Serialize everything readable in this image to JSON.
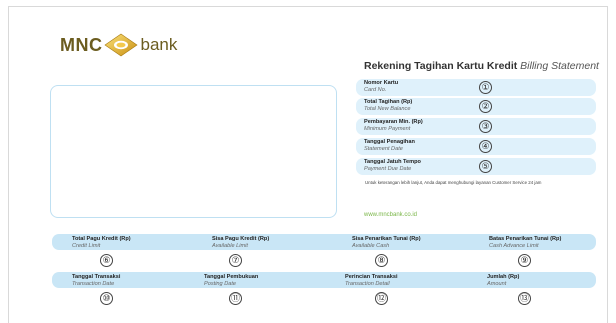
{
  "logo": {
    "left_text": "MNC",
    "right_text": "bank"
  },
  "header": {
    "title": "Rekening Tagihan Kartu Kredit",
    "title_en": "Billing Statement"
  },
  "info_rows": [
    {
      "label": "Nomor Kartu",
      "sub": "Card No.",
      "num": "①"
    },
    {
      "label": "Total Tagihan (Rp)",
      "sub": "Total New Balance",
      "num": "②"
    },
    {
      "label": "Pembayaran Min. (Rp)",
      "sub": "Minimum Payment",
      "num": "③"
    },
    {
      "label": "Tanggal Penagihan",
      "sub": "Statement Date",
      "num": "④"
    },
    {
      "label": "Tanggal Jatuh Tempo",
      "sub": "Payment Due Date",
      "num": "⑤"
    }
  ],
  "note": "Untuk keterangan lebih lanjut, Anda dapat menghubungi layanan Customer Service 24 jam",
  "website": "www.mncbank.co.id",
  "summary": [
    {
      "label": "Total Pagu Kredit (Rp)",
      "sub": "Credit Limit",
      "num": "⑥"
    },
    {
      "label": "Sisa Pagu Kredit (Rp)",
      "sub": "Available Limit",
      "num": "⑦"
    },
    {
      "label": "Sisa Penarikan Tunai (Rp)",
      "sub": "Available Cash",
      "num": "⑧"
    },
    {
      "label": "Batas Penarikan Tunai (Rp)",
      "sub": "Cash Advance Limit",
      "num": "⑨"
    }
  ],
  "transactions": [
    {
      "label": "Tanggal Transaksi",
      "sub": "Transaction Date",
      "num": "⑩"
    },
    {
      "label": "Tanggal Pembukuan",
      "sub": "Posting Date",
      "num": "⑪"
    },
    {
      "label": "Perincian Transaksi",
      "sub": "Transaction Detail",
      "num": "⑫"
    },
    {
      "label": "Jumlah (Rp)",
      "sub": "Amount",
      "num": "⑬"
    }
  ],
  "colors": {
    "band": "#c9e6f6",
    "row": "#dff1fb",
    "brand": "#6b5c1f",
    "accent_gold": "#e3b53b",
    "web": "#7ab648"
  }
}
